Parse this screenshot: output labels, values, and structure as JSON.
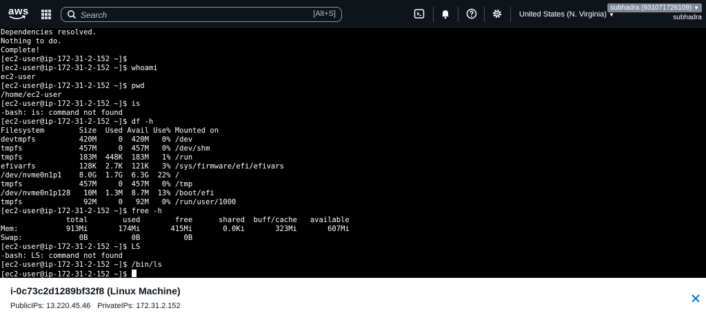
{
  "nav": {
    "logo_text": "aws",
    "search_placeholder": "Search",
    "search_shortcut": "[Alt+S]",
    "region": "United States (N. Virginia)",
    "account_name": "subhadra (931071726109)",
    "account_user": "subhadra"
  },
  "terminal": {
    "lines": [
      "Dependencies resolved.",
      "Nothing to do.",
      "Complete!",
      "[ec2-user@ip-172-31-2-152 ~]$",
      "[ec2-user@ip-172-31-2-152 ~]$ whoami",
      "ec2-user",
      "[ec2-user@ip-172-31-2-152 ~]$ pwd",
      "/home/ec2-user",
      "[ec2-user@ip-172-31-2-152 ~]$ is",
      "-bash: is: command not found",
      "[ec2-user@ip-172-31-2-152 ~]$ df -h",
      "Filesystem        Size  Used Avail Use% Mounted on",
      "devtmpfs          420M     0  420M   0% /dev",
      "tmpfs             457M     0  457M   0% /dev/shm",
      "tmpfs             183M  448K  183M   1% /run",
      "efivarfs          128K  2.7K  121K   3% /sys/firmware/efi/efivars",
      "/dev/nvme0n1p1    8.0G  1.7G  6.3G  22% /",
      "tmpfs             457M     0  457M   0% /tmp",
      "/dev/nvme0n1p128   10M  1.3M  8.7M  13% /boot/efi",
      "tmpfs              92M     0   92M   0% /run/user/1000",
      "[ec2-user@ip-172-31-2-152 ~]$ free -h",
      "               total        used        free      shared  buff/cache   available",
      "Mem:           913Mi       174Mi       415Mi       0.0Ki       323Mi       607Mi",
      "Swap:             0B          0B          0B",
      "[ec2-user@ip-172-31-2-152 ~]$ LS",
      "-bash: LS: command not found",
      "[ec2-user@ip-172-31-2-152 ~]$ /bin/ls",
      "[ec2-user@ip-172-31-2-152 ~]$ "
    ]
  },
  "instance": {
    "title": "i-0c73c2d1289bf32f8 (Linux Machine)",
    "public_ips": "PublicIPs: 13.220.45.46",
    "private_ips": "PrivateIPs: 172.31.2.152"
  }
}
